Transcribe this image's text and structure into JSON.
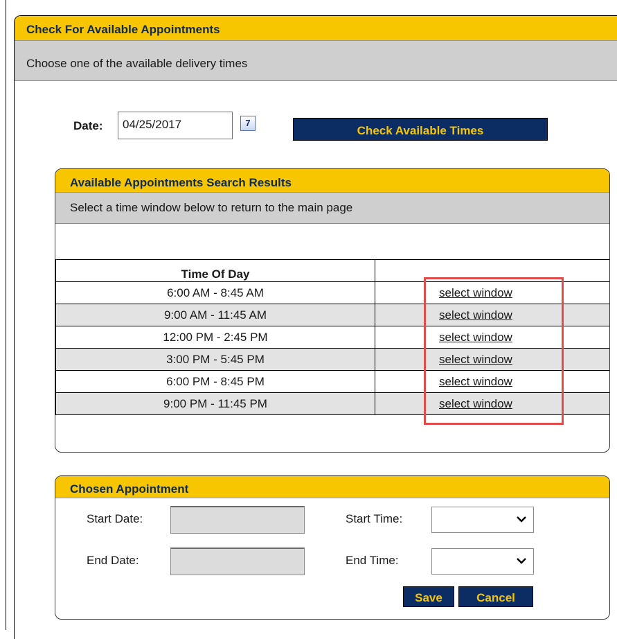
{
  "main": {
    "title": "Check For Available Appointments",
    "subtitle": "Choose one of the available delivery times"
  },
  "date": {
    "label": "Date:",
    "value": "04/25/2017",
    "calendar_glyph": "7",
    "check_button": "Check Available Times"
  },
  "results": {
    "title": "Available Appointments Search Results",
    "subtitle": "Select a time window below to return to the main page",
    "column_header": "Time Of Day",
    "rows": [
      {
        "time": "6:00 AM - 8:45 AM",
        "action": "select window"
      },
      {
        "time": "9:00 AM - 11:45 AM",
        "action": "select window"
      },
      {
        "time": "12:00 PM - 2:45 PM",
        "action": "select window"
      },
      {
        "time": "3:00 PM - 5:45 PM",
        "action": "select window"
      },
      {
        "time": "6:00 PM - 8:45 PM",
        "action": "select window"
      },
      {
        "time": "9:00 PM - 11:45 PM",
        "action": "select window"
      }
    ]
  },
  "chosen": {
    "title": "Chosen Appointment",
    "start_date_label": "Start Date:",
    "end_date_label": "End Date:",
    "start_time_label": "Start Time:",
    "end_time_label": "End Time:",
    "save": "Save",
    "cancel": "Cancel"
  },
  "colors": {
    "header_yellow": "#f7c600",
    "header_text": "#0c2a5a",
    "button_navy": "#0b2d63",
    "highlight_red": "#e04b4b"
  }
}
